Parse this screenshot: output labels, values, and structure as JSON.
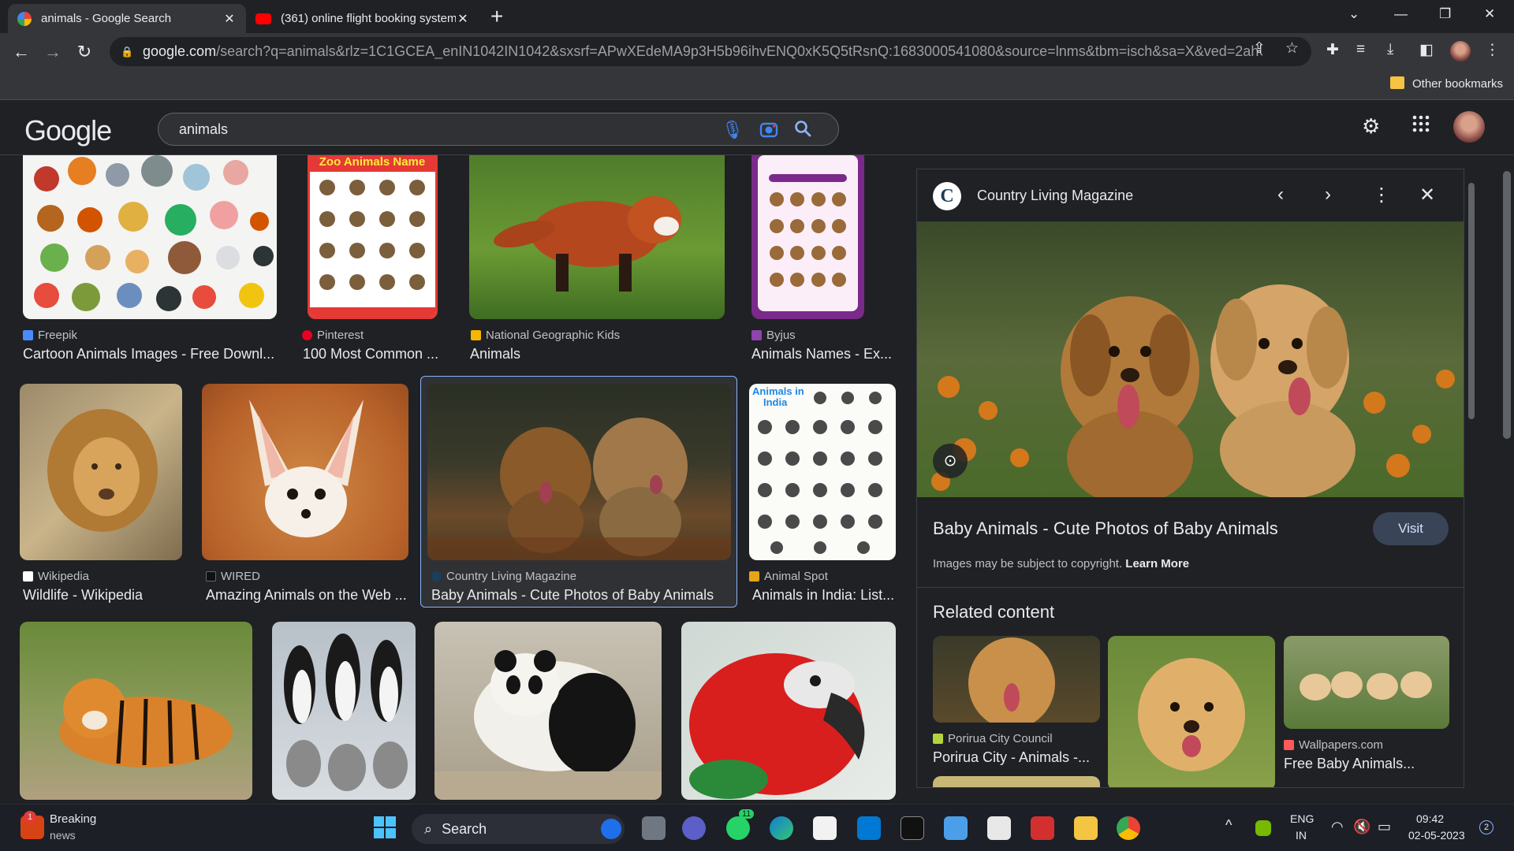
{
  "browser": {
    "tabs": [
      {
        "title": "animals - Google Search",
        "active": true,
        "icon": "google-icon"
      },
      {
        "title": "(361) online flight booking system",
        "active": false,
        "icon": "youtube-icon"
      }
    ],
    "url_host": "google.com",
    "url_rest": "/search?q=animals&rlz=1C1GCEA_enIN1042IN1042&sxsrf=APwXEdeMA9p3H5b96ihvENQ0xK5Q5tRsnQ:1683000541080&source=lnms&tbm=isch&sa=X&ved=2ahUKE...",
    "bookmarks_label": "Other bookmarks"
  },
  "google": {
    "logo": "Google",
    "query": "animals"
  },
  "results": [
    {
      "source": "Freepik",
      "caption": "Cartoon Animals Images - Free Downl...",
      "source_color": "#4a8cff"
    },
    {
      "source": "Pinterest",
      "caption": "100 Most Common ...",
      "source_color": "#e60023"
    },
    {
      "source": "National Geographic Kids",
      "caption": "Animals",
      "source_color": "#f5b800"
    },
    {
      "source": "Byjus",
      "caption": "Animals Names - Ex...",
      "source_color": "#8e44ad"
    },
    {
      "source": "Wikipedia",
      "caption": "Wildlife - Wikipedia",
      "source_color": "#ffffff"
    },
    {
      "source": "WIRED",
      "caption": "Amazing Animals on the Web ...",
      "source_color": "#111111"
    },
    {
      "source": "Country Living Magazine",
      "caption": "Baby Animals - Cute Photos of Baby Animals",
      "source_color": "#1a3e5c"
    },
    {
      "source": "Animal Spot",
      "caption": "Animals in India: List...",
      "source_color": "#e6a417"
    }
  ],
  "panel": {
    "source": "Country Living Magazine",
    "title": "Baby Animals - Cute Photos of Baby Animals",
    "visit_label": "Visit",
    "copyright": "Images may be subject to copyright.",
    "learn_more": "Learn More",
    "related_heading": "Related content",
    "related": [
      {
        "source": "Porirua City Council",
        "caption": "Porirua City - Animals -...",
        "source_color": "#b5d33d"
      },
      {
        "source": "",
        "caption": ""
      },
      {
        "source": "Wallpapers.com",
        "caption": "Free Baby Animals...",
        "source_color": "#ff5a5a"
      }
    ]
  },
  "taskbar": {
    "news_title": "Breaking",
    "news_sub": "news",
    "search_label": "Search",
    "lang_1": "ENG",
    "lang_2": "IN",
    "time": "09:42",
    "date": "02-05-2023",
    "notif_count": "2",
    "whatsapp_badge": "11",
    "news_badge": "1"
  }
}
